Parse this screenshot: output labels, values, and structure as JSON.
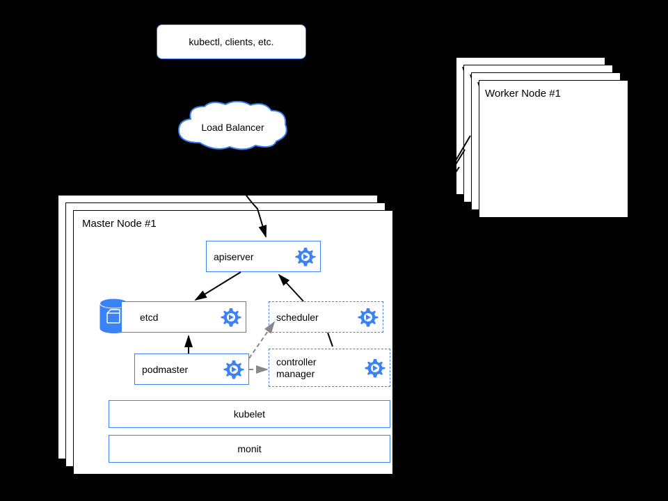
{
  "clients_label": "kubectl, clients, etc.",
  "load_balancer_label": "Load Balancer",
  "worker_title": "Worker Node #1",
  "master_title": "Master Node #1",
  "components": {
    "apiserver": "apiserver",
    "etcd": "etcd",
    "scheduler": "scheduler",
    "podmaster": "podmaster",
    "controller_manager": "controller\nmanager",
    "kubelet": "kubelet",
    "monit": "monit"
  },
  "colors": {
    "blue": "#3b82f6",
    "border": "#3b82f6"
  }
}
